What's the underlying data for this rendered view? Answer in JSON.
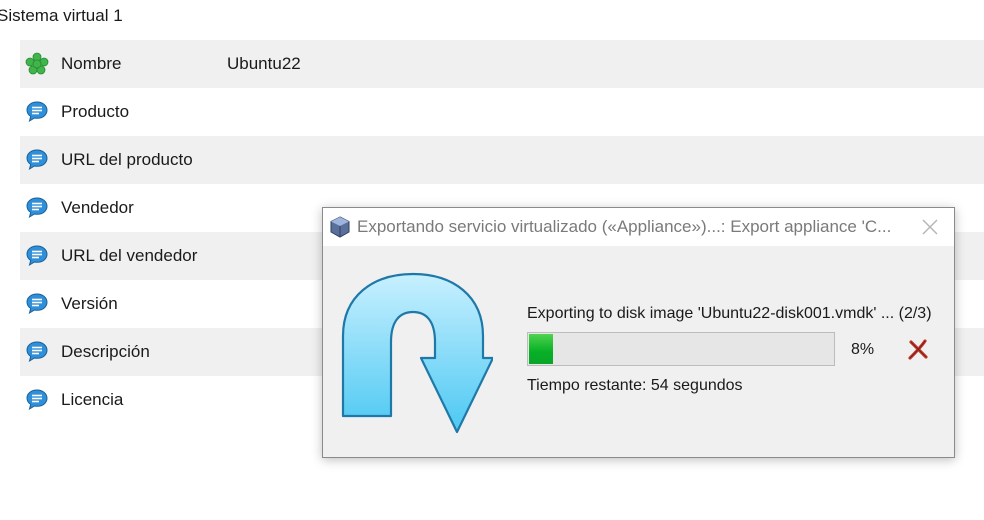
{
  "section": {
    "title": "Sistema virtual 1"
  },
  "properties": [
    {
      "icon": "green-gear-icon",
      "label": "Nombre",
      "value": "Ubuntu22"
    },
    {
      "icon": "speech-bubble-icon",
      "label": "Producto",
      "value": ""
    },
    {
      "icon": "speech-bubble-icon",
      "label": "URL del producto",
      "value": ""
    },
    {
      "icon": "speech-bubble-icon",
      "label": "Vendedor",
      "value": ""
    },
    {
      "icon": "speech-bubble-icon",
      "label": "URL del vendedor",
      "value": ""
    },
    {
      "icon": "speech-bubble-icon",
      "label": "Versión",
      "value": ""
    },
    {
      "icon": "speech-bubble-icon",
      "label": "Descripción",
      "value": ""
    },
    {
      "icon": "speech-bubble-icon",
      "label": "Licencia",
      "value": ""
    }
  ],
  "dialog": {
    "title": "Exportando servicio virtualizado («Appliance»)...: Export appliance 'C...",
    "status": "Exporting to disk image 'Ubuntu22-disk001.vmdk' ... (2/3)",
    "progress_percent": 8,
    "progress_label": "8%",
    "remaining": "Tiempo restante: 54 segundos"
  },
  "colors": {
    "progress_fill": "#06b025",
    "arrow_fill": "#7fd8f8",
    "cancel_red": "#c0392b"
  }
}
